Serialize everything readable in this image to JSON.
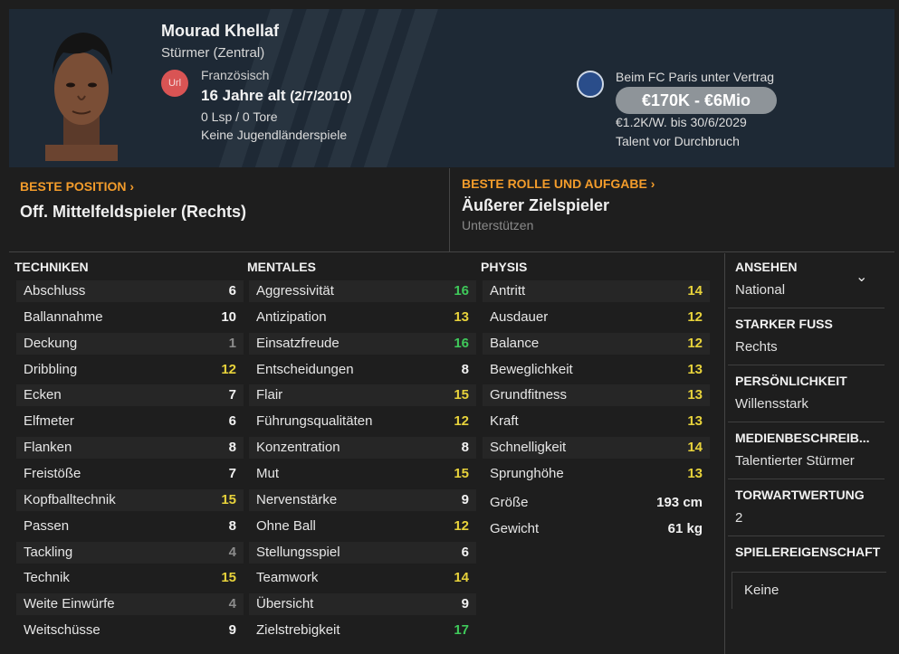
{
  "player": {
    "name": "Mourad Khellaf",
    "position": "Stürmer (Zentral)",
    "nationality_code": "Url",
    "nationality": "Französisch",
    "age": "16 Jahre alt",
    "dob": "(2/7/2010)",
    "caps": "0 Lsp / 0 Tore",
    "youth_caps": "Keine Jugendländerspiele"
  },
  "contract": {
    "club": "Beim FC Paris unter Vertrag",
    "value": "€170K - €6Mio",
    "wage": "€1.2K/W. bis 30/6/2029",
    "status": "Talent vor Durchbruch"
  },
  "best_position": {
    "label": "BESTE POSITION",
    "value": "Off. Mittelfeldspieler (Rechts)"
  },
  "best_role": {
    "label": "BESTE ROLLE UND AUFGABE",
    "value": "Äußerer Zielspieler",
    "duty": "Unterstützen"
  },
  "columns": {
    "technical": {
      "title": "TECHNIKEN",
      "items": [
        {
          "name": "Abschluss",
          "value": "6",
          "tier": "white"
        },
        {
          "name": "Ballannahme",
          "value": "10",
          "tier": "white"
        },
        {
          "name": "Deckung",
          "value": "1",
          "tier": "gray"
        },
        {
          "name": "Dribbling",
          "value": "12",
          "tier": "yellow"
        },
        {
          "name": "Ecken",
          "value": "7",
          "tier": "white"
        },
        {
          "name": "Elfmeter",
          "value": "6",
          "tier": "white"
        },
        {
          "name": "Flanken",
          "value": "8",
          "tier": "white"
        },
        {
          "name": "Freistöße",
          "value": "7",
          "tier": "white"
        },
        {
          "name": "Kopfballtechnik",
          "value": "15",
          "tier": "yellow"
        },
        {
          "name": "Passen",
          "value": "8",
          "tier": "white"
        },
        {
          "name": "Tackling",
          "value": "4",
          "tier": "gray"
        },
        {
          "name": "Technik",
          "value": "15",
          "tier": "yellow"
        },
        {
          "name": "Weite Einwürfe",
          "value": "4",
          "tier": "gray"
        },
        {
          "name": "Weitschüsse",
          "value": "9",
          "tier": "white"
        }
      ]
    },
    "mental": {
      "title": "MENTALES",
      "items": [
        {
          "name": "Aggressivität",
          "value": "16",
          "tier": "green"
        },
        {
          "name": "Antizipation",
          "value": "13",
          "tier": "yellow"
        },
        {
          "name": "Einsatzfreude",
          "value": "16",
          "tier": "green"
        },
        {
          "name": "Entscheidungen",
          "value": "8",
          "tier": "white"
        },
        {
          "name": "Flair",
          "value": "15",
          "tier": "yellow"
        },
        {
          "name": "Führungsqualitäten",
          "value": "12",
          "tier": "yellow"
        },
        {
          "name": "Konzentration",
          "value": "8",
          "tier": "white"
        },
        {
          "name": "Mut",
          "value": "15",
          "tier": "yellow"
        },
        {
          "name": "Nervenstärke",
          "value": "9",
          "tier": "white"
        },
        {
          "name": "Ohne Ball",
          "value": "12",
          "tier": "yellow"
        },
        {
          "name": "Stellungsspiel",
          "value": "6",
          "tier": "white"
        },
        {
          "name": "Teamwork",
          "value": "14",
          "tier": "yellow"
        },
        {
          "name": "Übersicht",
          "value": "9",
          "tier": "white"
        },
        {
          "name": "Zielstrebigkeit",
          "value": "17",
          "tier": "green"
        }
      ]
    },
    "physical": {
      "title": "PHYSIS",
      "items": [
        {
          "name": "Antritt",
          "value": "14",
          "tier": "yellow"
        },
        {
          "name": "Ausdauer",
          "value": "12",
          "tier": "yellow"
        },
        {
          "name": "Balance",
          "value": "12",
          "tier": "yellow"
        },
        {
          "name": "Beweglichkeit",
          "value": "13",
          "tier": "yellow"
        },
        {
          "name": "Grundfitness",
          "value": "13",
          "tier": "yellow"
        },
        {
          "name": "Kraft",
          "value": "13",
          "tier": "yellow"
        },
        {
          "name": "Schnelligkeit",
          "value": "14",
          "tier": "yellow"
        },
        {
          "name": "Sprunghöhe",
          "value": "13",
          "tier": "yellow"
        }
      ],
      "extra": [
        {
          "name": "Größe",
          "value": "193 cm"
        },
        {
          "name": "Gewicht",
          "value": "61 kg"
        }
      ]
    }
  },
  "info": [
    {
      "label": "ANSEHEN",
      "value": "National"
    },
    {
      "label": "STARKER FUSS",
      "value": "Rechts"
    },
    {
      "label": "PERSÖNLICHKEIT",
      "value": "Willensstark"
    },
    {
      "label": "MEDIENBESCHREIB...",
      "value": "Talentierter Stürmer"
    },
    {
      "label": "TORWARTWERTUNG",
      "value": "2"
    },
    {
      "label": "SPIELEREIGENSCHAFT",
      "value": "Keine"
    }
  ],
  "colors": {
    "accent": "#f39c2b",
    "good": "#3fc95a",
    "mid": "#e7d23b",
    "low": "#8c8c8c"
  }
}
